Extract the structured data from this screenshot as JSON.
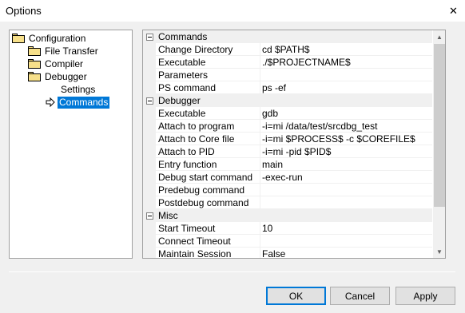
{
  "window": {
    "title": "Options",
    "close_glyph": "✕"
  },
  "tree": {
    "items": [
      {
        "label": "Configuration",
        "icon": "folder-open-icon"
      },
      {
        "label": "File Transfer",
        "icon": "folder-icon"
      },
      {
        "label": "Compiler",
        "icon": "folder-icon"
      },
      {
        "label": "Debugger",
        "icon": "folder-open-icon"
      },
      {
        "label": "Settings"
      },
      {
        "label": "Commands",
        "selected": true,
        "icon": "arrow-right-icon"
      }
    ]
  },
  "grid": {
    "categories": [
      {
        "name": "Commands",
        "rows": [
          {
            "name": "Change Directory",
            "value": "cd $PATH$"
          },
          {
            "name": "Executable",
            "value": "./$PROJECTNAME$"
          },
          {
            "name": "Parameters",
            "value": ""
          },
          {
            "name": "PS command",
            "value": "ps -ef"
          }
        ]
      },
      {
        "name": "Debugger",
        "rows": [
          {
            "name": "Executable",
            "value": "gdb"
          },
          {
            "name": "Attach to program",
            "value": "-i=mi /data/test/srcdbg_test"
          },
          {
            "name": "Attach to Core file",
            "value": "-i=mi $PROCESS$ -c $COREFILE$"
          },
          {
            "name": "Attach to PID",
            "value": "-i=mi -pid $PID$"
          },
          {
            "name": "Entry function",
            "value": "main"
          },
          {
            "name": "Debug start command",
            "value": "-exec-run"
          },
          {
            "name": "Predebug command",
            "value": ""
          },
          {
            "name": "Postdebug command",
            "value": ""
          }
        ]
      },
      {
        "name": "Misc",
        "rows": [
          {
            "name": "Start Timeout",
            "value": "10"
          },
          {
            "name": "Connect Timeout",
            "value": ""
          },
          {
            "name": "Maintain Session",
            "value": "False"
          }
        ]
      }
    ]
  },
  "buttons": {
    "ok": "OK",
    "cancel": "Cancel",
    "apply": "Apply"
  }
}
